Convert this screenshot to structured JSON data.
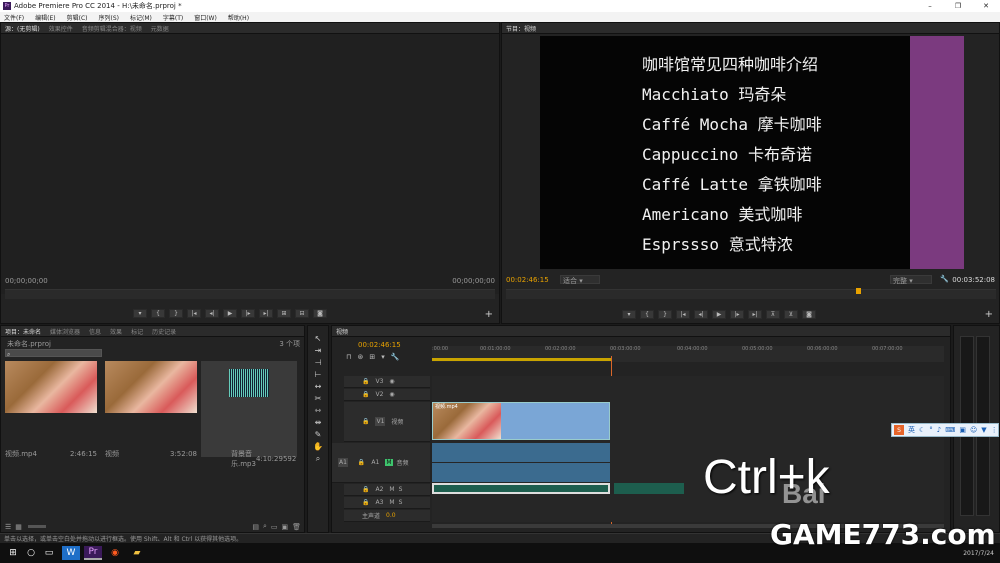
{
  "window": {
    "title": "Adobe Premiere Pro CC 2014 - H:\\未命名.prproj *",
    "controls": [
      "–",
      "❐",
      "✕"
    ]
  },
  "menu": [
    "文件(F)",
    "编辑(E)",
    "剪辑(C)",
    "序列(S)",
    "标记(M)",
    "字幕(T)",
    "窗口(W)",
    "帮助(H)"
  ],
  "source_panel": {
    "tabs": [
      "源：(无剪辑)",
      "效果控件",
      "音频剪辑混合器：视频",
      "元数据"
    ],
    "tc_left": "00;00;00;00",
    "tc_right": "00;00;00;00"
  },
  "program_panel": {
    "tab": "节目：视频",
    "lines": [
      "咖啡馆常见四种咖啡介绍",
      "Macchiato 玛奇朵",
      "Caffé Mocha 摩卡咖啡",
      "Cappuccino 卡布奇诺",
      "Caffé Latte 拿铁咖啡",
      "Americano 美式咖啡",
      "Esprssso 意式特浓"
    ],
    "tc_left": "00:02:46:15",
    "fit": "适合",
    "quality": "完整",
    "tc_right": "00:03:52:08"
  },
  "project_panel": {
    "tabs": [
      "项目：未命名",
      "媒体浏览器",
      "信息",
      "效果",
      "标记",
      "历史记录"
    ],
    "name": "未命名.prproj",
    "count": "3 个项",
    "items": [
      {
        "name": "视频.mp4",
        "duration": "2:46:15"
      },
      {
        "name": "视频",
        "duration": "3:52:08"
      },
      {
        "name": "背景音乐.mp3",
        "duration": "4:10:29592"
      }
    ]
  },
  "timeline": {
    "tab": "视频",
    "tc": "00:02:46:15",
    "ticks": [
      ":00:00",
      "00:01:00:00",
      "00:02:00:00",
      "00:03:00:00",
      "00:04:00:00",
      "00:05:00:00",
      "00:06:00:00",
      "00:07:00:00"
    ],
    "tracks": [
      "V3",
      "V2",
      "V1",
      "A1",
      "A2",
      "A3"
    ],
    "v1_name": "视频",
    "a1_name": "音频",
    "master": "主声道",
    "master_val": "0.0",
    "clip_label": "视频.mp4"
  },
  "overlay": {
    "shortcut": "Ctrl+k",
    "brand": "GAME773.com",
    "watermark": "Bai"
  },
  "status": {
    "hint": "单击以选择，或单击空白处并拖动以进行框选。使用 Shift、Alt 和 Ctrl 以获得其他选项。",
    "date": "2017/7/24"
  },
  "ime": {
    "label": "英"
  },
  "colors": {
    "timecode_blue": "#6da7e6",
    "timecode_orange": "#e8a200",
    "purple_bar": "#7b3a7f",
    "clip_blue": "#7aa6d6",
    "clip_green": "#1d5e4e"
  }
}
